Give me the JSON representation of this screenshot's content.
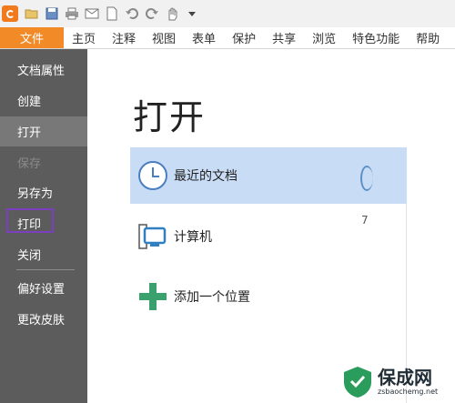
{
  "quick_access": {
    "icons": [
      "app-logo-icon",
      "folder-open-icon",
      "save-icon",
      "print-icon",
      "email-icon",
      "new-document-icon",
      "undo-icon",
      "redo-icon",
      "hand-tool-icon",
      "dropdown-icon"
    ]
  },
  "ribbon": {
    "file_tab": "文件",
    "tabs": [
      "主页",
      "注释",
      "视图",
      "表单",
      "保护",
      "共享",
      "浏览",
      "特色功能",
      "帮助"
    ]
  },
  "sidebar": {
    "items": [
      {
        "label": "文档属性",
        "state": "normal"
      },
      {
        "label": "创建",
        "state": "normal"
      },
      {
        "label": "打开",
        "state": "active"
      },
      {
        "label": "保存",
        "state": "disabled"
      },
      {
        "label": "另存为",
        "state": "normal"
      },
      {
        "label": "打印",
        "state": "highlighted"
      },
      {
        "label": "关闭",
        "state": "normal"
      },
      {
        "label": "偏好设置",
        "state": "normal"
      },
      {
        "label": "更改皮肤",
        "state": "normal"
      }
    ]
  },
  "main": {
    "title": "打开",
    "locations": [
      {
        "label": "最近的文档",
        "icon": "clock-icon",
        "selected": true
      },
      {
        "label": "计算机",
        "icon": "computer-icon",
        "selected": false
      },
      {
        "label": "添加一个位置",
        "icon": "plus-icon",
        "selected": false
      }
    ],
    "right_peek_text": "7"
  },
  "watermark": {
    "title": "保成网",
    "url": "zsbaochemg.net"
  },
  "colors": {
    "file_tab": "#f28a28",
    "sidebar": "#5c5c5c",
    "sidebar_active": "#787878",
    "selected_row": "#c9dcf5",
    "highlight_box": "#7b3fbf",
    "plus_green": "#3aa06d"
  }
}
